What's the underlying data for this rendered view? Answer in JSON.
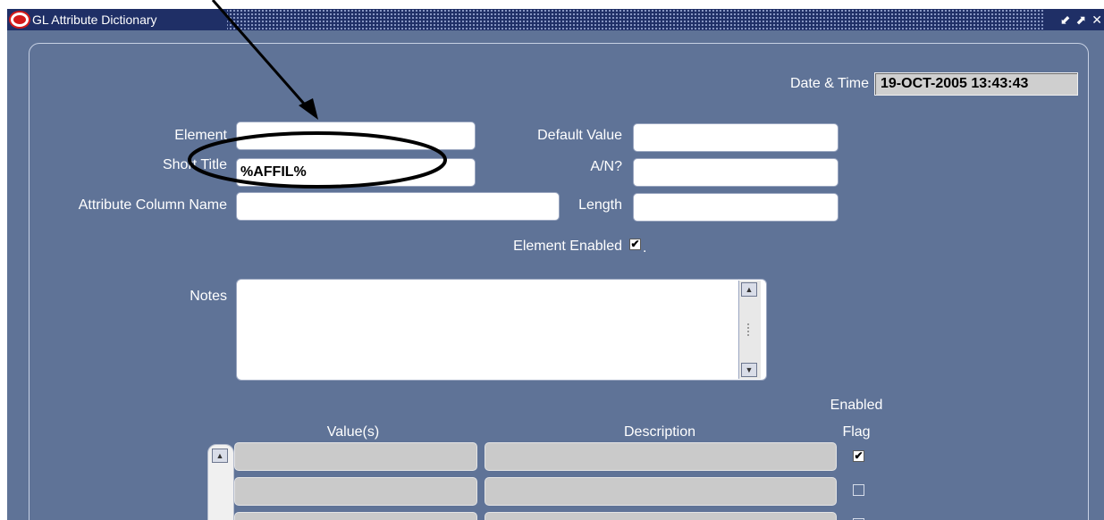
{
  "window": {
    "title": "GL Attribute Dictionary",
    "controls": {
      "minimize": "⬋",
      "maximize": "⬈",
      "close": "✕"
    }
  },
  "datetime": {
    "label": "Date & Time",
    "value": "19-OCT-2005 13:43:43"
  },
  "form": {
    "element": {
      "label": "Element",
      "value": ""
    },
    "short_title": {
      "label": "Short Title",
      "value": "%AFFIL%"
    },
    "attribute_column_name": {
      "label": "Attribute Column Name",
      "value": ""
    },
    "default_value": {
      "label": "Default Value",
      "value": ""
    },
    "an": {
      "label": "A/N?",
      "value": ""
    },
    "length": {
      "label": "Length",
      "value": ""
    },
    "element_enabled": {
      "label": "Element Enabled",
      "checked": true,
      "suffix": "."
    },
    "notes": {
      "label": "Notes",
      "value": ""
    }
  },
  "values_table": {
    "columns": {
      "values": "Value(s)",
      "description": "Description",
      "enabled_flag_line1": "Enabled",
      "enabled_flag_line2": "Flag"
    },
    "rows": [
      {
        "value": "",
        "description": "",
        "enabled": true
      },
      {
        "value": "",
        "description": "",
        "enabled": false
      },
      {
        "value": "",
        "description": "",
        "enabled": false
      }
    ]
  },
  "icons": {
    "checkmark": "✔",
    "scroll_up": "▲",
    "scroll_down": "▼",
    "logo": "oracle-logo"
  },
  "colors": {
    "window_bg": "#5f7397",
    "titlebar": "#1f2f66",
    "annotation": "#000000",
    "logo_red": "#d31a1a"
  }
}
